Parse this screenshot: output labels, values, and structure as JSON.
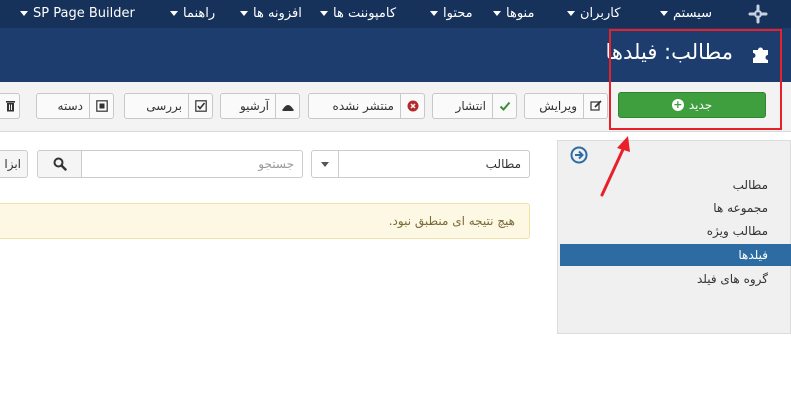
{
  "topbar": {
    "menus": [
      "SP Page Builder",
      "راهنما",
      "افزونه ها",
      "کامپوننت ها",
      "محتوا",
      "منوها",
      "کاربران",
      "سیستم"
    ]
  },
  "header": {
    "title": "مطالب: فیلدها"
  },
  "toolbar": {
    "new_label": "جدید",
    "edit_label": "ویرایش",
    "publish_label": "انتشار",
    "unpublish_label": "منتشر نشده",
    "archive_label": "آرشیو",
    "checkin_label": "بررسی",
    "batch_label": "دسته"
  },
  "sidebar": {
    "items": [
      {
        "label": "مطالب",
        "active": false
      },
      {
        "label": "مجموعه ها",
        "active": false
      },
      {
        "label": "مطالب ویژه",
        "active": false
      },
      {
        "label": "فیلدها",
        "active": true
      },
      {
        "label": "گروه های فیلد",
        "active": false
      }
    ]
  },
  "filters": {
    "context_selected": "مطالب",
    "search_placeholder": "جستجو",
    "tools_label": "ابزا"
  },
  "alert": {
    "message": "هیچ نتیجه ای منطبق نبود."
  },
  "colors": {
    "topbar": "#17325a",
    "header": "#1c3d6e",
    "new_button": "#3f9f3f",
    "active_item": "#2d6ca2",
    "annotation": "#e8202a",
    "alert_bg": "#fcf8e3"
  }
}
